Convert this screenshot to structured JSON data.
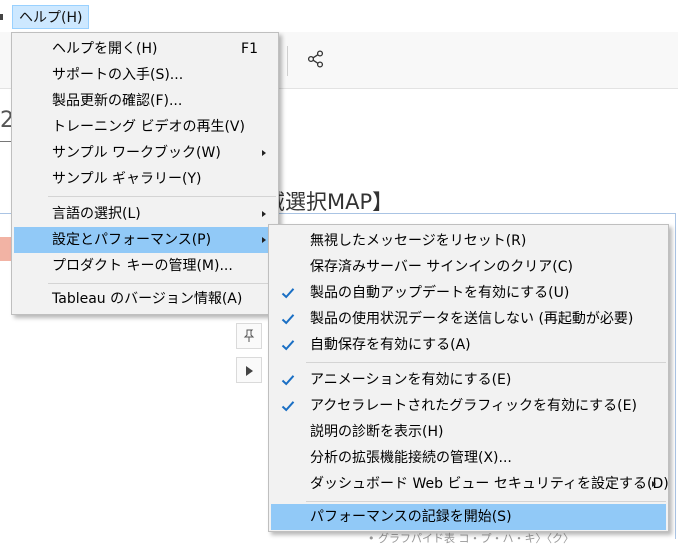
{
  "menubar": {
    "help_label": "ヘルプ(H)"
  },
  "background": {
    "fragment_left": "2",
    "dashboard_title_fragment": "域選択MAP】",
    "bottom_fragment": "• グラフパイド表  コ・プ・ハ・キ〉〈ク〉"
  },
  "icons": {
    "share": "share-icon",
    "pin": "pin-icon",
    "play": "play-icon",
    "check": "check-icon",
    "check_color": "#1a6fc4"
  },
  "help_menu": {
    "items": [
      {
        "label": "ヘルプを開く(H)",
        "accelerator": "F1"
      },
      {
        "label": "サポートの入手(S)..."
      },
      {
        "label": "製品更新の確認(F)..."
      },
      {
        "label": "トレーニング ビデオの再生(V)"
      },
      {
        "label": "サンプル ワークブック(W)"
      },
      {
        "label": "サンプル ギャラリー(Y)"
      },
      {
        "label": "言語の選択(L)"
      },
      {
        "label": "設定とパフォーマンス(P)"
      },
      {
        "label": "プロダクト キーの管理(M)..."
      },
      {
        "label": "Tableau のバージョン情報(A)"
      }
    ]
  },
  "settings_menu": {
    "items": [
      {
        "label": "無視したメッセージをリセット(R)",
        "checked": false
      },
      {
        "label": "保存済みサーバー サインインのクリア(C)",
        "checked": false
      },
      {
        "label": "製品の自動アップデートを有効にする(U)",
        "checked": true
      },
      {
        "label": "製品の使用状況データを送信しない (再起動が必要)",
        "checked": true
      },
      {
        "label": "自動保存を有効にする(A)",
        "checked": true
      },
      {
        "label": "アニメーションを有効にする(E)",
        "checked": true
      },
      {
        "label": "アクセラレートされたグラフィックを有効にする(E)",
        "checked": true
      },
      {
        "label": "説明の診断を表示(H)",
        "checked": false
      },
      {
        "label": "分析の拡張機能接続の管理(X)...",
        "checked": false
      },
      {
        "label": "ダッシュボード Web ビュー セキュリティを設定する(D)",
        "checked": false
      },
      {
        "label": "パフォーマンスの記録を開始(S)",
        "checked": false
      }
    ]
  },
  "colors": {
    "highlight": "#91c9f7",
    "menu_bg": "#f2f2f2",
    "menubar_selected": "#cde8ff"
  }
}
